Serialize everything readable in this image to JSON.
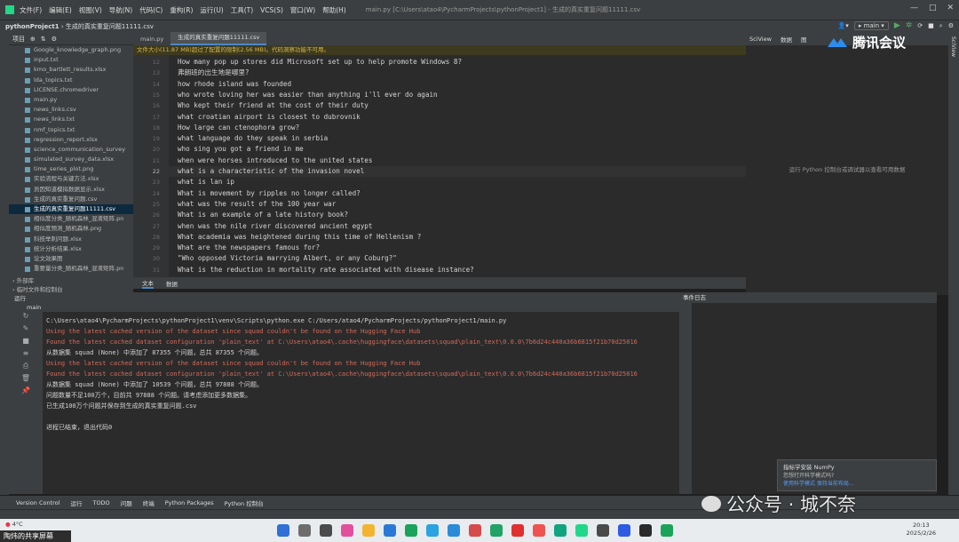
{
  "titlebar": {
    "menus": [
      "文件(F)",
      "编辑(E)",
      "视图(V)",
      "导航(N)",
      "代码(C)",
      "重构(R)",
      "运行(U)",
      "工具(T)",
      "VCS(S)",
      "窗口(W)",
      "帮助(H)"
    ],
    "path": "main.py [C:\\Users\\atao4\\PycharmProjects\\pythonProject1] - 生成的真实重复问题11111.csv"
  },
  "navbar": {
    "project": "pythonProject1",
    "file": "生成的真实重复问题11111.csv",
    "branch": "main"
  },
  "project_panel": {
    "title": "项目",
    "files": [
      "Google_knowledge_graph.png",
      "input.txt",
      "kmo_bartlett_results.xlsx",
      "lda_topics.txt",
      "LICENSE.chromedriver",
      "main.py",
      "news_links.csv",
      "news_links.txt",
      "nmf_topics.txt",
      "regression_report.xlsx",
      "science_communication_survey",
      "simulated_survey_data.xlsx",
      "time_series_plot.png",
      "实验流程与关键方法.xlsx",
      "员因知道模拟数据显示.xlsx",
      "生成的真实重复问题.csv",
      "生成的真实重复问题11111.csv",
      "相似度分类_随机森林_混淆矩阵.pn",
      "相似度预测_随机森林.png",
      "科技举刺问题.xlsx",
      "统计分析结果.xlsx",
      "论文效果图",
      "重要量分类_随机森林_混淆矩阵.pn"
    ],
    "selected_index": 16,
    "footer_items": [
      "外部库",
      "临时文件和控制台"
    ]
  },
  "editor": {
    "tabs": [
      "main.py",
      "生成的真实重复问题11111.csv"
    ],
    "active_tab": 1,
    "warning": "文件大小(11.87 MB)超过了配置的限制(2.56 MB)。代码洞察功能不可用。",
    "first_line_number": 12,
    "current_line_number": 22,
    "lines": [
      "How many pop up stores did Microsoft set up to help promote Windows 8?",
      "弗朗班的出生地是哪里?",
      "how rhode island was founded",
      "who wrote loving her was easier than anything i'll ever do again",
      "Who kept their friend at the cost of their duty",
      "what croatian airport is closest to dubrovnik",
      "How large can ctenophora grow?",
      "what language do they speak in serbia",
      "who sing you got a friend in me",
      "when were horses introduced to the united states",
      "what is a characteristic of the invasion novel",
      "what is lan ip",
      "What is movement by ripples no longer called?",
      "what was the result of the 100 year war",
      "What is an example of a late history book?",
      "when was the nile river discovered ancient egypt",
      "What academia was heightened during this time of Hellenism ?",
      "What are the newspapers famous for?",
      "\"Who opposed Victoria marrying Albert, or any Coburg?\"",
      "What is the reduction in mortality rate associated with disease instance?"
    ],
    "bottom_tabs": [
      "文本",
      "数据"
    ]
  },
  "sciview": {
    "title": "SciView",
    "tabs": [
      "数据",
      "图"
    ],
    "message": "运行 Python 控制台或调试器以查看可用数据"
  },
  "meeting": {
    "name": "腾讯会议"
  },
  "run_panel": {
    "header": "运行",
    "tab": "main",
    "output": [
      {
        "text": "C:\\Users\\atao4\\PycharmProjects\\pythonProject1\\venv\\Scripts\\python.exe C:/Users/atao4/PycharmProjects/pythonProject1/main.py",
        "kind": "normal"
      },
      {
        "text": "Using the latest cached version of the dataset since squad couldn't be found on the Hugging Face Hub",
        "kind": "err"
      },
      {
        "text": "Found the latest cached dataset configuration 'plain_text' at C:\\Users\\atao4\\.cache\\huggingface\\datasets\\squad\\plain_text\\0.0.0\\7b6d24c440a36b6815f21b70d25016",
        "kind": "err"
      },
      {
        "text": "从数据集 squad (None) 中添加了 87355 个问题，总共 87355 个问题。",
        "kind": "normal"
      },
      {
        "text": "Using the latest cached version of the dataset since squad couldn't be found on the Hugging Face Hub",
        "kind": "err"
      },
      {
        "text": "Found the latest cached dataset configuration 'plain_text' at C:\\Users\\atao4\\.cache\\huggingface\\datasets\\squad\\plain_text\\0.0.0\\7b6d24c440a36b6815f21b70d25016",
        "kind": "err"
      },
      {
        "text": "从数据集 squad (None) 中添加了 10539 个问题，总共 97888 个问题。",
        "kind": "normal"
      },
      {
        "text": "问题数量不足100万个，目前共 97888 个问题。请考虑添加更多数据集。",
        "kind": "normal"
      },
      {
        "text": "已生成100万个问题并保存到生成的真实重复问题.csv",
        "kind": "normal"
      },
      {
        "text": "",
        "kind": "normal"
      },
      {
        "text": "进程已结束，退出代码0",
        "kind": "normal"
      }
    ]
  },
  "event_log": {
    "title": "事件日志"
  },
  "notification": {
    "title": "指标学安装 NumPy",
    "body": "您想打开科学模式吗?",
    "links": "使用科学模式    保持当前布局..."
  },
  "toolstrip": [
    "Version Control",
    "运行",
    "TODO",
    "问题",
    "终端",
    "Python Packages",
    "Python 控制台"
  ],
  "taskbar": {
    "weather": "4°C",
    "share_label": "陶炜的共享屏幕",
    "time": "20:13",
    "date": "2025/2/26"
  },
  "watermark": "公众号 · 城不奈"
}
